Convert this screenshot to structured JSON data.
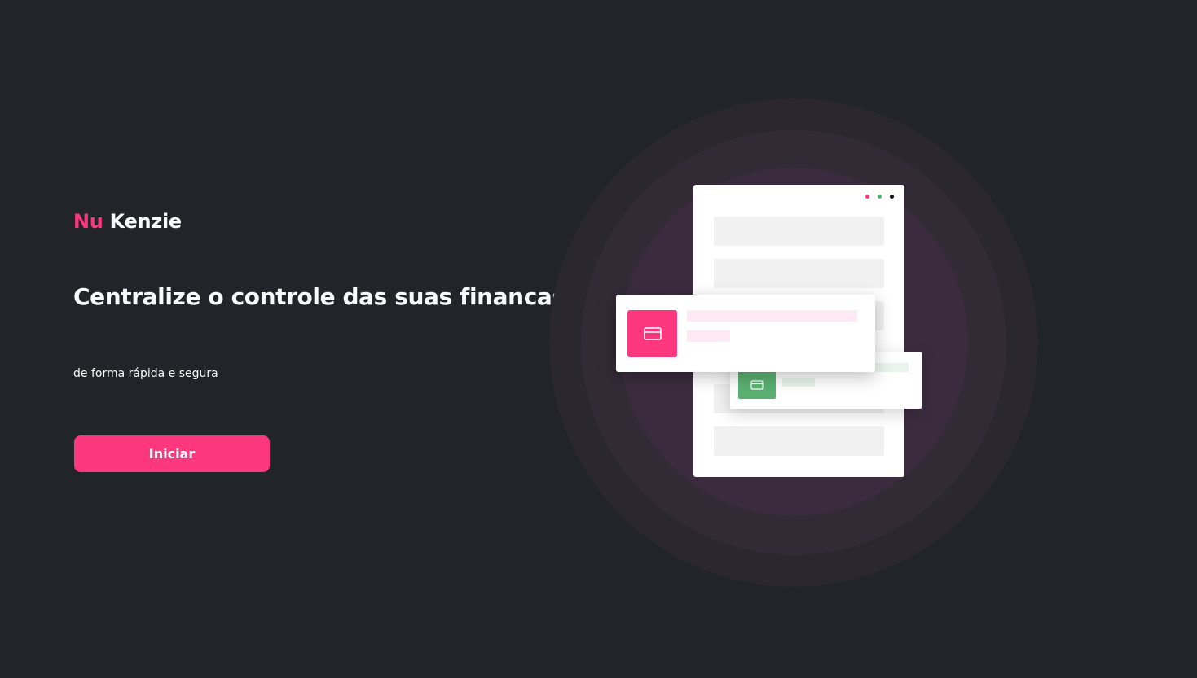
{
  "brand": {
    "part1": "Nu",
    "part2": "Kenzie",
    "accent_color": "#FD377E",
    "text_color": "#F8F9FA"
  },
  "hero": {
    "headline": "Centralize o controle das suas financas",
    "subtitle": "de forma rápida e segura",
    "cta_label": "Iniciar"
  },
  "illustration": {
    "window_dot_colors": [
      "#FD377E",
      "#4ABA72",
      "#111111"
    ],
    "front_card_icon": "credit-card-icon",
    "back_card_icon": "credit-card-icon",
    "front_card_color": "#FD377E",
    "back_card_color": "#5BB071"
  },
  "colors": {
    "background": "#212529"
  }
}
